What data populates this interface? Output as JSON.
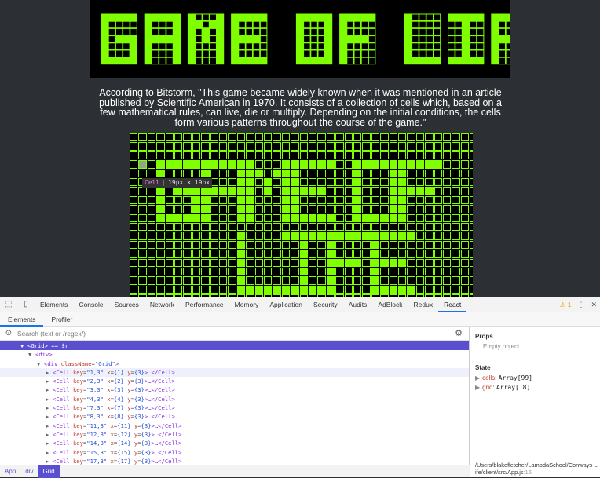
{
  "app": {
    "banner_title": "GAME OF LIFE",
    "quote": "According to Bitstorm, \"This game became widely known when it was mentioned in an article published by Scientific American in 1970. It consists of a collection of cells which, based on a few mathematical rules, can live, die or multiply. Depending on the initial conditions, the cells form various patterns throughout the course of the game.\"",
    "grid_pattern": [
      "GAME OF",
      "LIFE"
    ],
    "tooltip": {
      "name": "Cell",
      "size": "19px × 19px"
    },
    "colors": {
      "accent": "#7fff00",
      "background": "#2c2f33",
      "selection": "#5a4fcf"
    }
  },
  "devtools": {
    "tabs": [
      "Elements",
      "Console",
      "Sources",
      "Network",
      "Performance",
      "Memory",
      "Application",
      "Security",
      "Audits",
      "AdBlock",
      "Redux",
      "React"
    ],
    "active_tab": "React",
    "warning_count": "1",
    "sub_tabs": [
      "Elements",
      "Profiler"
    ],
    "search_placeholder": "Search (text or /regex/)",
    "tree": {
      "root": {
        "tag": "<Grid>",
        "suffix": " == $r"
      },
      "div": "<div>",
      "div_grid": {
        "open": "<div ",
        "attr": "className",
        "value": "\"Grid\"",
        "close": ">"
      },
      "cells": [
        {
          "key": "\"1,3\"",
          "x": "{1}",
          "y": "{3}"
        },
        {
          "key": "\"2,3\"",
          "x": "{2}",
          "y": "{3}"
        },
        {
          "key": "\"3,3\"",
          "x": "{3}",
          "y": "{3}"
        },
        {
          "key": "\"4,3\"",
          "x": "{4}",
          "y": "{3}"
        },
        {
          "key": "\"7,3\"",
          "x": "{7}",
          "y": "{3}"
        },
        {
          "key": "\"8,3\"",
          "x": "{8}",
          "y": "{3}"
        },
        {
          "key": "\"11,3\"",
          "x": "{11}",
          "y": "{3}"
        },
        {
          "key": "\"12,3\"",
          "x": "{12}",
          "y": "{3}"
        },
        {
          "key": "\"14,3\"",
          "x": "{14}",
          "y": "{3}"
        },
        {
          "key": "\"15,3\"",
          "x": "{15}",
          "y": "{3}"
        },
        {
          "key": "\"17,3\"",
          "x": "{17}",
          "y": "{3}"
        }
      ]
    },
    "props_title": "Props",
    "props_empty": "Empty object",
    "state_title": "State",
    "state": [
      {
        "key": "cells",
        "value": "Array[99]"
      },
      {
        "key": "grid",
        "value": "Array[18]"
      }
    ],
    "file_path": "/Users/blakefletcher/LambdaSchool/Conways-Life/client/src/App.js",
    "file_line": ":16",
    "breadcrumb": [
      "App",
      "div",
      "Grid"
    ]
  }
}
